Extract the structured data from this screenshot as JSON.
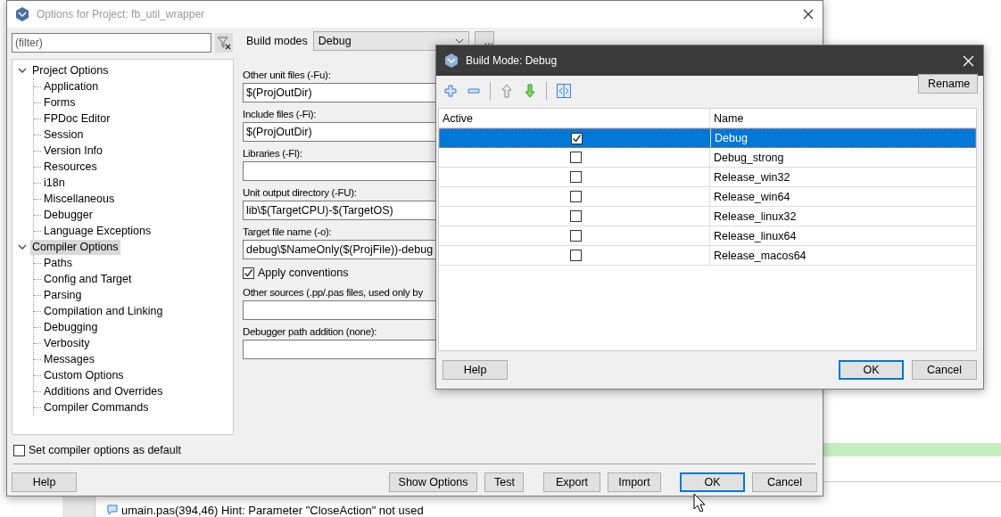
{
  "options_window": {
    "title": "Options for Project: fb_util_wrapper",
    "filter": {
      "placeholder": "(filter)"
    },
    "tree": [
      {
        "label": "Project Options",
        "expanded": true,
        "selected": false,
        "children": [
          {
            "label": "Application",
            "selected": false
          },
          {
            "label": "Forms",
            "selected": false
          },
          {
            "label": "FPDoc Editor",
            "selected": false
          },
          {
            "label": "Session",
            "selected": false
          },
          {
            "label": "Version Info",
            "selected": false
          },
          {
            "label": "Resources",
            "selected": false
          },
          {
            "label": "i18n",
            "selected": false
          },
          {
            "label": "Miscellaneous",
            "selected": false
          },
          {
            "label": "Debugger",
            "selected": false
          },
          {
            "label": "Language Exceptions",
            "selected": false
          }
        ]
      },
      {
        "label": "Compiler Options",
        "expanded": true,
        "selected": true,
        "children": [
          {
            "label": "Paths",
            "selected": false
          },
          {
            "label": "Config and Target",
            "selected": false
          },
          {
            "label": "Parsing",
            "selected": false
          },
          {
            "label": "Compilation and Linking",
            "selected": false
          },
          {
            "label": "Debugging",
            "selected": false
          },
          {
            "label": "Verbosity",
            "selected": false
          },
          {
            "label": "Messages",
            "selected": false
          },
          {
            "label": "Custom Options",
            "selected": false
          },
          {
            "label": "Additions and Overrides",
            "selected": false
          },
          {
            "label": "Compiler Commands",
            "selected": false
          }
        ]
      }
    ],
    "build_modes": {
      "label": "Build modes",
      "value": "Debug",
      "more": "..."
    },
    "fields": [
      {
        "kind": "field",
        "label": "Other unit files (-Fu):",
        "value": "$(ProjOutDir)"
      },
      {
        "kind": "field",
        "label": "Include files (-Fi):",
        "value": "$(ProjOutDir)"
      },
      {
        "kind": "field",
        "label": "Libraries (-Fl):"
      },
      {
        "kind": "field",
        "label": "Unit output directory (-FU):",
        "value": "lib\\$(TargetCPU)-$(TargetOS)"
      },
      {
        "kind": "field",
        "label": "Target file name (-o):",
        "value": "debug\\$NameOnly($(ProjFile))-debug"
      },
      {
        "kind": "checkbox",
        "label": "Apply conventions",
        "checked": true
      },
      {
        "kind": "field",
        "label": "Other sources (.pp/.pas files, used only by"
      },
      {
        "kind": "field",
        "label": "Debugger path addition (none):"
      }
    ],
    "set_default": {
      "label": "Set compiler options as default",
      "checked": false
    },
    "buttons": [
      {
        "label": "Help",
        "default": false
      },
      {
        "label": "Show Options",
        "default": false
      },
      {
        "label": "Test",
        "default": false
      },
      {
        "label": "Export",
        "default": false
      },
      {
        "label": "Import",
        "default": false
      },
      {
        "label": "OK",
        "default": true
      },
      {
        "label": "Cancel",
        "default": false
      }
    ]
  },
  "build_mode_dialog": {
    "title": "Build Mode: Debug",
    "rename": "Rename",
    "columns": [
      "Active",
      "Name"
    ],
    "rows": [
      {
        "name": "Debug",
        "active": true,
        "selected": true
      },
      {
        "name": "Debug_strong",
        "active": false,
        "selected": false
      },
      {
        "name": "Release_win32",
        "active": false,
        "selected": false
      },
      {
        "name": "Release_win64",
        "active": false,
        "selected": false
      },
      {
        "name": "Release_linux32",
        "active": false,
        "selected": false
      },
      {
        "name": "Release_linux64",
        "active": false,
        "selected": false
      },
      {
        "name": "Release_macos64",
        "active": false,
        "selected": false
      }
    ],
    "buttons": [
      {
        "label": "Help",
        "default": false
      },
      {
        "label": "OK",
        "default": true
      },
      {
        "label": "Cancel",
        "default": false
      }
    ]
  },
  "messages": [
    {
      "text": "umain.pas(394,46) Hint: Parameter \"CloseAction\" not used"
    }
  ]
}
